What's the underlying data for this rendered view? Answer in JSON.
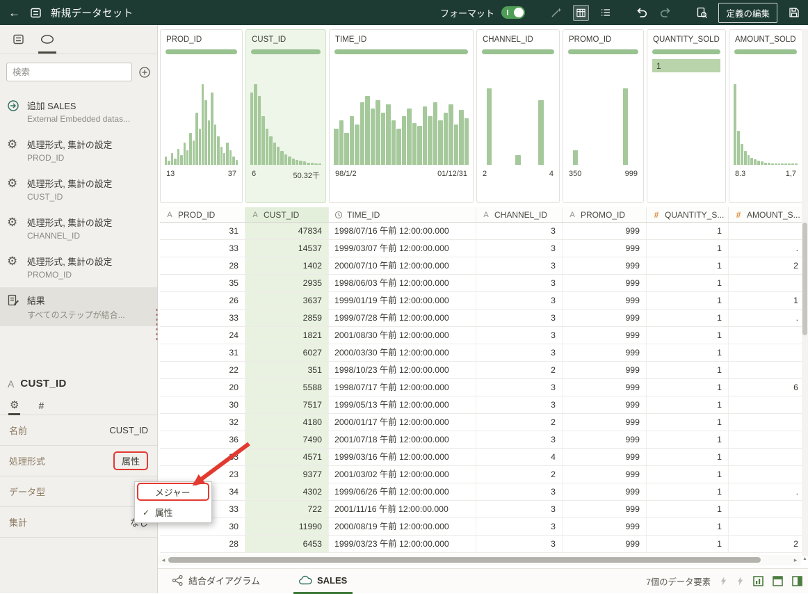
{
  "topbar": {
    "title": "新規データセット",
    "format_label": "フォーマット",
    "format_on": true,
    "edit_definition": "定義の編集"
  },
  "sidebar": {
    "search": {
      "placeholder": "検索"
    },
    "steps": [
      {
        "icon": "add",
        "title": "追加 SALES",
        "subtitle": "External Embedded datas...",
        "selected": false
      },
      {
        "icon": "gear",
        "title": "処理形式, 集計の設定",
        "subtitle": "PROD_ID",
        "selected": false
      },
      {
        "icon": "gear",
        "title": "処理形式, 集計の設定",
        "subtitle": "CUST_ID",
        "selected": false
      },
      {
        "icon": "gear",
        "title": "処理形式, 集計の設定",
        "subtitle": "CHANNEL_ID",
        "selected": false
      },
      {
        "icon": "gear",
        "title": "処理形式, 集計の設定",
        "subtitle": "PROMO_ID",
        "selected": false
      },
      {
        "icon": "result",
        "title": "結果",
        "subtitle": "すべてのステップが結合...",
        "selected": true
      }
    ],
    "properties": {
      "type_glyph": "A",
      "name": "CUST_ID",
      "rows": [
        {
          "label": "名前",
          "value": "CUST_ID",
          "boxed": false
        },
        {
          "label": "処理形式",
          "value": "属性",
          "boxed": true
        },
        {
          "label": "データ型",
          "value": "",
          "boxed": false
        },
        {
          "label": "集計",
          "value": "なし",
          "boxed": false
        }
      ]
    },
    "menu": {
      "items": [
        {
          "label": "メジャー",
          "checked": false,
          "boxed": true
        },
        {
          "label": "属性",
          "checked": true,
          "boxed": false
        }
      ]
    }
  },
  "grid": {
    "columns": [
      {
        "name": "PROD_ID",
        "header": "PROD_ID",
        "type": "attr",
        "selected": false,
        "min": "13",
        "max": "37",
        "hist": [
          0.1,
          0.05,
          0.15,
          0.08,
          0.2,
          0.12,
          0.28,
          0.18,
          0.4,
          0.3,
          0.65,
          0.45,
          1.0,
          0.8,
          0.55,
          0.9,
          0.5,
          0.35,
          0.22,
          0.15,
          0.28,
          0.18,
          0.1,
          0.06
        ]
      },
      {
        "name": "CUST_ID",
        "header": "CUST_ID",
        "type": "attr",
        "selected": true,
        "min": "6",
        "max": "50.32千",
        "hist": [
          0.9,
          1.0,
          0.85,
          0.6,
          0.45,
          0.35,
          0.28,
          0.22,
          0.17,
          0.13,
          0.1,
          0.08,
          0.06,
          0.05,
          0.04,
          0.03,
          0.03,
          0.02,
          0.02
        ]
      },
      {
        "name": "TIME_ID",
        "header": "TIME_ID",
        "type": "time",
        "selected": false,
        "min": "98/1/2",
        "max": "01/12/31",
        "hist": [
          0.45,
          0.55,
          0.4,
          0.6,
          0.5,
          0.78,
          0.85,
          0.7,
          0.8,
          0.65,
          0.75,
          0.55,
          0.45,
          0.6,
          0.7,
          0.52,
          0.48,
          0.72,
          0.6,
          0.78,
          0.55,
          0.65,
          0.75,
          0.5,
          0.68,
          0.58
        ]
      },
      {
        "name": "CHANNEL_ID",
        "header": "CHANNEL_ID",
        "type": "attr",
        "selected": false,
        "min": "2",
        "max": "4",
        "hist": [
          0,
          0.95,
          0,
          0,
          0,
          0,
          0.12,
          0,
          0,
          0,
          0.8,
          0,
          0
        ]
      },
      {
        "name": "PROMO_ID",
        "header": "PROMO_ID",
        "type": "attr",
        "selected": false,
        "min": "350",
        "max": "999",
        "hist": [
          0,
          0.18,
          0,
          0,
          0,
          0,
          0,
          0,
          0,
          0,
          0.95,
          0,
          0
        ]
      },
      {
        "name": "QUANTITY_SOLD",
        "header": "QUANTITY_S...",
        "type": "num",
        "selected": false,
        "top_value": "1"
      },
      {
        "name": "AMOUNT_SOLD",
        "header": "AMOUNT_S...",
        "type": "num",
        "selected": false,
        "min": "8.3",
        "max": "1,7",
        "hist": [
          1.0,
          0.42,
          0.26,
          0.17,
          0.12,
          0.09,
          0.07,
          0.05,
          0.04,
          0.03,
          0.03,
          0.02,
          0.02,
          0.02,
          0.01,
          0.01,
          0.01,
          0.01,
          0.01
        ]
      }
    ],
    "rows": [
      [
        "31",
        "47834",
        "1998/07/16 午前 12:00:00.000",
        "3",
        "999",
        "1",
        ""
      ],
      [
        "33",
        "14537",
        "1999/03/07 午前 12:00:00.000",
        "3",
        "999",
        "1",
        "."
      ],
      [
        "28",
        "1402",
        "2000/07/10 午前 12:00:00.000",
        "3",
        "999",
        "1",
        "2"
      ],
      [
        "35",
        "2935",
        "1998/06/03 午前 12:00:00.000",
        "3",
        "999",
        "1",
        ""
      ],
      [
        "26",
        "3637",
        "1999/01/19 午前 12:00:00.000",
        "3",
        "999",
        "1",
        "1"
      ],
      [
        "33",
        "2859",
        "1999/07/28 午前 12:00:00.000",
        "3",
        "999",
        "1",
        "."
      ],
      [
        "24",
        "1821",
        "2001/08/30 午前 12:00:00.000",
        "3",
        "999",
        "1",
        ""
      ],
      [
        "31",
        "6027",
        "2000/03/30 午前 12:00:00.000",
        "3",
        "999",
        "1",
        ""
      ],
      [
        "22",
        "351",
        "1998/10/23 午前 12:00:00.000",
        "2",
        "999",
        "1",
        ""
      ],
      [
        "20",
        "5588",
        "1998/07/17 午前 12:00:00.000",
        "3",
        "999",
        "1",
        "6"
      ],
      [
        "30",
        "7517",
        "1999/05/13 午前 12:00:00.000",
        "3",
        "999",
        "1",
        ""
      ],
      [
        "32",
        "4180",
        "2000/01/17 午前 12:00:00.000",
        "2",
        "999",
        "1",
        ""
      ],
      [
        "36",
        "7490",
        "2001/07/18 午前 12:00:00.000",
        "3",
        "999",
        "1",
        ""
      ],
      [
        "33",
        "4571",
        "1999/03/16 午前 12:00:00.000",
        "4",
        "999",
        "1",
        ""
      ],
      [
        "23",
        "9377",
        "2001/03/02 午前 12:00:00.000",
        "2",
        "999",
        "1",
        ""
      ],
      [
        "34",
        "4302",
        "1999/06/26 午前 12:00:00.000",
        "3",
        "999",
        "1",
        "."
      ],
      [
        "33",
        "722",
        "2001/11/16 午前 12:00:00.000",
        "3",
        "999",
        "1",
        ""
      ],
      [
        "30",
        "11990",
        "2000/08/19 午前 12:00:00.000",
        "3",
        "999",
        "1",
        ""
      ],
      [
        "28",
        "6453",
        "1999/03/23 午前 12:00:00.000",
        "3",
        "999",
        "1",
        "2"
      ]
    ]
  },
  "bottombar": {
    "tabs": [
      {
        "label": "結合ダイアグラム",
        "selected": false
      },
      {
        "label": "SALES",
        "selected": true
      }
    ],
    "elements_count": "7個のデータ要素"
  },
  "colors": {
    "header_bg": "#1e3b33",
    "histogram_green": "#a6c99c",
    "selected_tint": "#e9f2e1",
    "annotation_red": "#e23a31",
    "tab_underline_green": "#3e7b3a"
  }
}
